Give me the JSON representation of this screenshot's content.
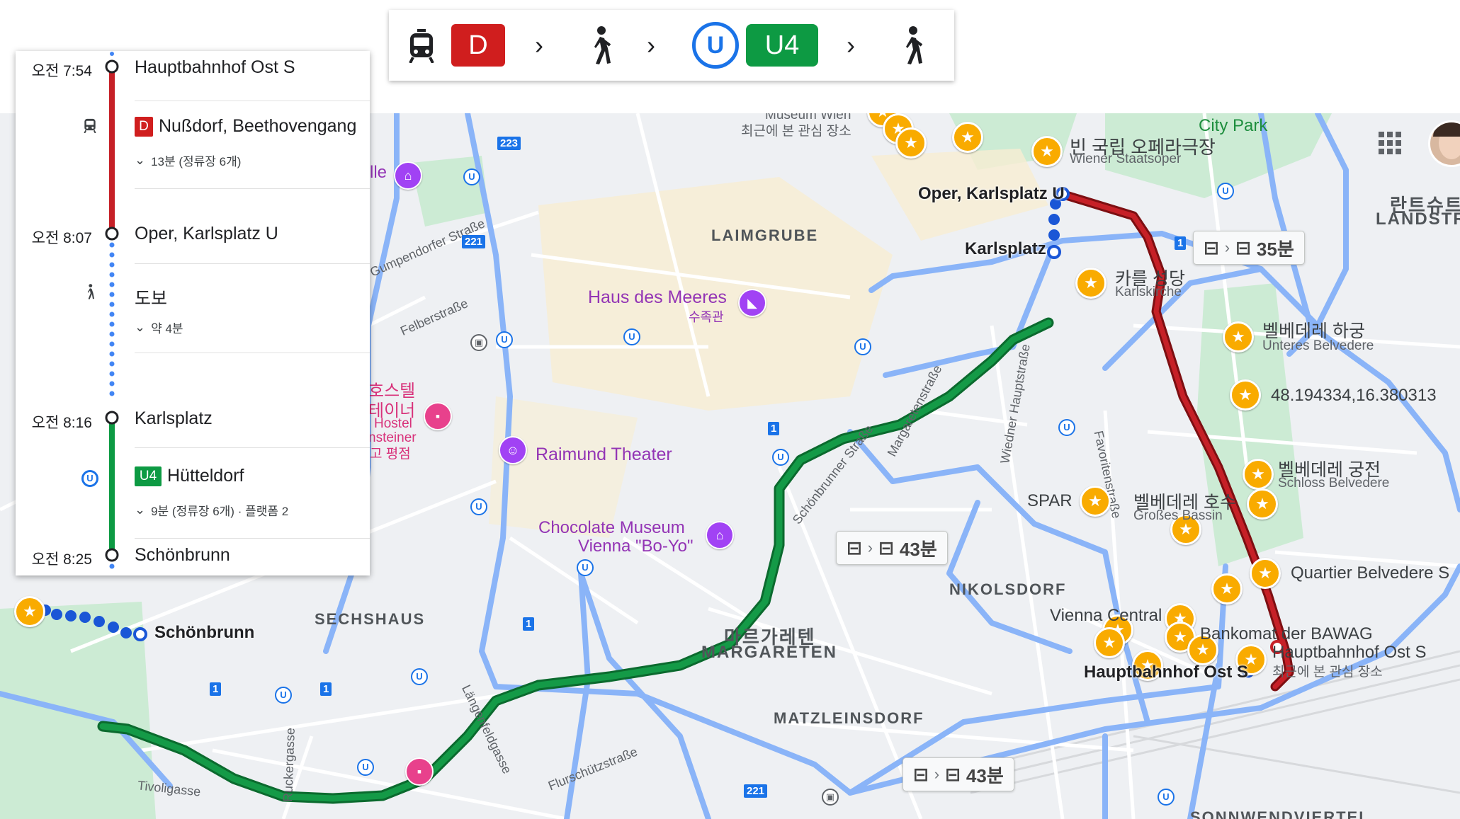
{
  "strip": {
    "tram_icon": "tram-icon",
    "line_d": "D",
    "walk_icon": "walk-icon",
    "ubahn_icon": "U",
    "line_u4": "U4",
    "chevron": "›"
  },
  "itinerary": {
    "stops": [
      {
        "time": "오전 7:54",
        "name": "Hauptbahnhof Ost S"
      },
      {
        "time": "오전 8:07",
        "name": "Oper, Karlsplatz U"
      },
      {
        "time": "오전 8:16",
        "name": "Karlsplatz"
      },
      {
        "time": "오전 8:25",
        "name": "Schönbrunn"
      }
    ],
    "legs": [
      {
        "badge": "D",
        "headsign": "Nußdorf, Beethovengang",
        "detail": "13분 (정류장 6개)"
      },
      {
        "label": "도보",
        "detail": "약 4분"
      },
      {
        "badge": "U4",
        "headsign": "Hütteldorf",
        "detail": "9분 (정류장 6개) · 플랫폼 2"
      }
    ]
  },
  "map": {
    "districts": [
      "LAIMGRUBE",
      "SECHSHAUS",
      "NIKOLSDORF",
      "마르가레텐",
      "MARGARETEN",
      "MATZLEINSDORF",
      "SONNWENDVIERTEL",
      "란트슈트",
      "LANDSTR"
    ],
    "streets": [
      "Gumpendorfer Straße",
      "Felberstraße",
      "Schönbrunner Straße",
      "Margaretenstraße",
      "Wiedner Hauptstraße",
      "Favoritenstraße",
      "Längenfeldgasse",
      "Ruckergasse",
      "Tivoligasse",
      "Flurschützstraße"
    ],
    "highways": [
      "223",
      "221",
      "1",
      "1",
      "1",
      "1",
      "1",
      "221"
    ],
    "pois": {
      "museum_top": "Museum Wien",
      "museum_top_sub": "최근에 본 관심 장소",
      "city_park": "City Park",
      "opera_kr": "빈 국립 오페라극장",
      "opera_de": "Wiener Staatsoper",
      "karlskirche_kr": "카를 성당",
      "karlskirche_de": "Karlskirche",
      "belvedere_lower_kr": "벨베데레 하궁",
      "belvedere_lower_de": "Unteres Belvedere",
      "coords": "48.194334,16.380313",
      "belvedere_kr": "벨베데레 궁전",
      "belvedere_de": "Schloss Belvedere",
      "pond_kr": "벨베데레 호수",
      "pond_de": "Großes Bassin",
      "spar": "SPAR",
      "haus_meeres": "Haus des Meeres",
      "haus_meeres_kr": "수족관",
      "raimund": "Raimund Theater",
      "choc1": "Chocolate Museum",
      "choc2": "Vienna \"Bo-Yo\"",
      "hostel_kr1": "호스텔",
      "hostel_kr2": "테이너",
      "hostel_de1": "Hostel",
      "hostel_de2": "nsteiner",
      "hostel_kr3": "고 평점",
      "vienna_central": "Vienna Central",
      "bankomat": "Bankomat der BAWAG",
      "hbf_ost": "Hauptbahnhof Ost S",
      "hbf_ost_sub": "최근에 본 관심 장소",
      "quartier": "Quartier Belvedere S",
      "lle": "lle"
    },
    "stations": {
      "oper": "Oper, Karlsplatz U",
      "karlsplatz": "Karlsplatz",
      "schoenbrunn": "Schönbrunn",
      "hbf": "Hauptbahnhof Ost S"
    },
    "route_labels": [
      {
        "duration": "35분"
      },
      {
        "duration": "43분"
      },
      {
        "duration": "43분"
      }
    ],
    "colors": {
      "tram_d": "#b3181b",
      "u4": "#0d8b3c",
      "walk": "#1a56d6",
      "alt_route": "#8ab4f8"
    }
  }
}
